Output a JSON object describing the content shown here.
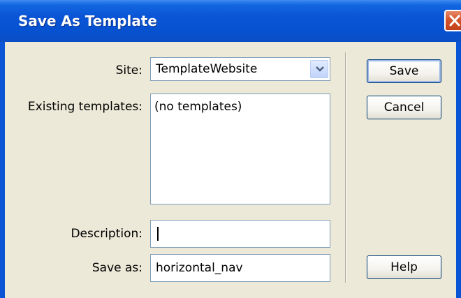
{
  "dialog": {
    "title": "Save As Template",
    "close_icon": "close-icon"
  },
  "form": {
    "site_label": "Site:",
    "site_value": "TemplateWebsite",
    "existing_label": "Existing templates:",
    "existing_items": [
      "(no templates)"
    ],
    "description_label": "Description:",
    "description_value": "",
    "save_as_label": "Save as:",
    "save_as_value": "horizontal_nav"
  },
  "buttons": {
    "save": "Save",
    "cancel": "Cancel",
    "help": "Help"
  },
  "colors": {
    "titlebar": "#0a55d6",
    "dialog_bg": "#ece9d8",
    "close_button": "#d5542c"
  }
}
